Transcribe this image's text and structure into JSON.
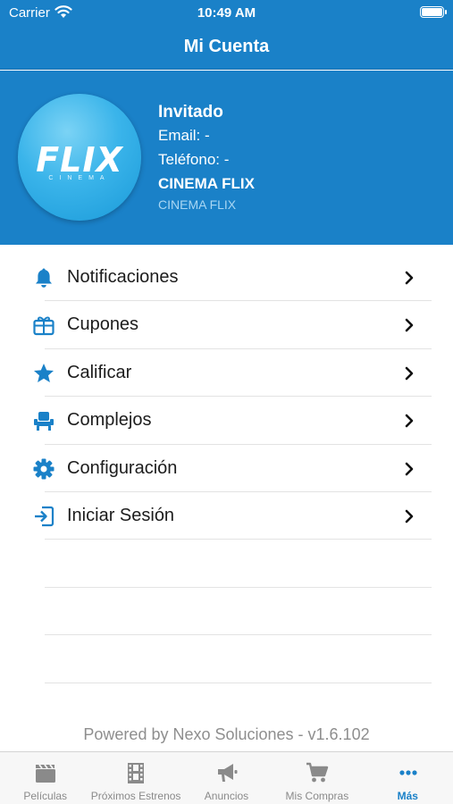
{
  "status_bar": {
    "carrier": "Carrier",
    "time": "10:49 AM"
  },
  "nav": {
    "title": "Mi Cuenta"
  },
  "profile": {
    "logo_text": "FLIX",
    "logo_sub": "CINEMA",
    "name": "Invitado",
    "email": "Email: -",
    "phone": "Teléfono: -",
    "company": "CINEMA FLIX",
    "company_sub": "CINEMA FLIX"
  },
  "menu": {
    "items": [
      {
        "label": "Notificaciones",
        "icon": "bell-icon"
      },
      {
        "label": "Cupones",
        "icon": "gift-ticket-icon"
      },
      {
        "label": "Calificar",
        "icon": "star-icon"
      },
      {
        "label": "Complejos",
        "icon": "cinema-seat-icon"
      },
      {
        "label": "Configuración",
        "icon": "gear-icon"
      },
      {
        "label": "Iniciar Sesión",
        "icon": "sign-in-icon"
      }
    ]
  },
  "footer": {
    "text": "Powered by Nexo Soluciones - v1.6.102"
  },
  "tabs": [
    {
      "label": "Películas",
      "icon": "clapperboard-icon"
    },
    {
      "label": "Próximos Estrenos",
      "icon": "film-strip-icon"
    },
    {
      "label": "Anuncios",
      "icon": "megaphone-icon"
    },
    {
      "label": "Mis Compras",
      "icon": "cart-icon"
    },
    {
      "label": "Más",
      "icon": "more-icon",
      "active": true
    }
  ],
  "colors": {
    "primary": "#1a81c8",
    "tab_inactive": "#8a8a8a",
    "text": "#1c1c1c",
    "footer_text": "#8e8e8e"
  }
}
